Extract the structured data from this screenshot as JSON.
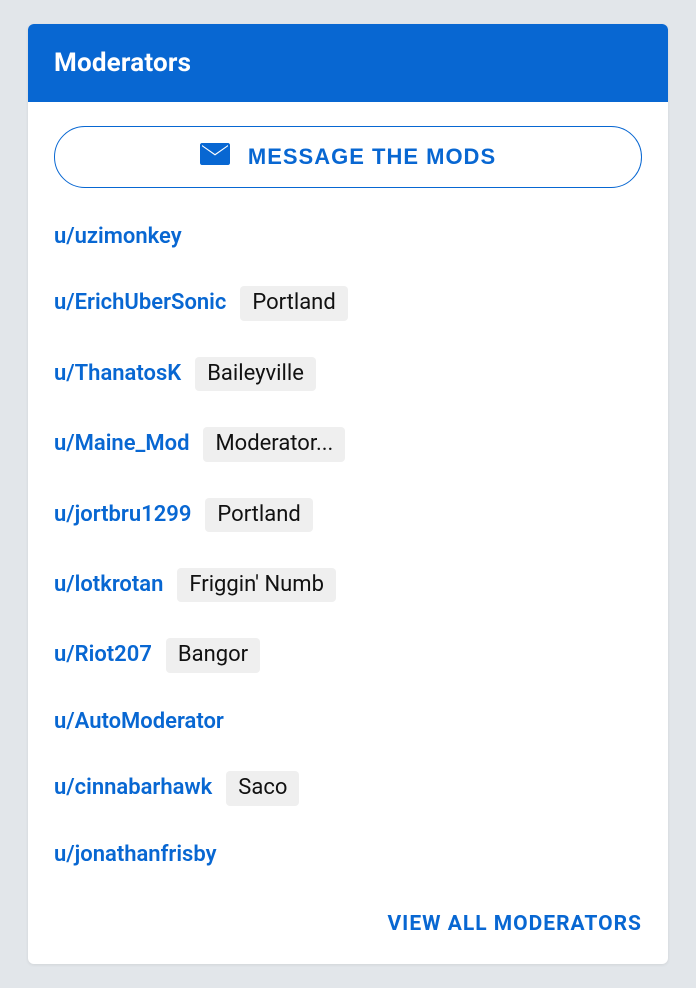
{
  "header": {
    "title": "Moderators"
  },
  "message_button": {
    "label": "MESSAGE THE MODS"
  },
  "moderators": [
    {
      "username": "u/uzimonkey",
      "flair": ""
    },
    {
      "username": "u/ErichUberSonic",
      "flair": "Portland"
    },
    {
      "username": "u/ThanatosK",
      "flair": "Baileyville"
    },
    {
      "username": "u/Maine_Mod",
      "flair": "Moderator..."
    },
    {
      "username": "u/jortbru1299",
      "flair": "Portland"
    },
    {
      "username": "u/lotkrotan",
      "flair": "Friggin' Numb"
    },
    {
      "username": "u/Riot207",
      "flair": "Bangor"
    },
    {
      "username": "u/AutoModerator",
      "flair": ""
    },
    {
      "username": "u/cinnabarhawk",
      "flair": "Saco"
    },
    {
      "username": "u/jonathanfrisby",
      "flair": ""
    }
  ],
  "view_all": {
    "label": "VIEW ALL MODERATORS"
  }
}
